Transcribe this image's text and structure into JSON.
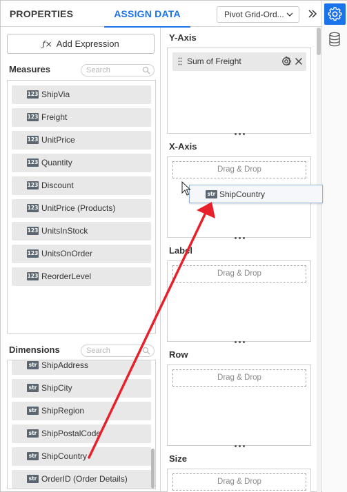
{
  "header": {
    "tabs": [
      {
        "label": "PROPERTIES",
        "active": false
      },
      {
        "label": "ASSIGN DATA",
        "active": true
      }
    ],
    "widget_select": "Pivot Grid-Ord..."
  },
  "left_panel": {
    "add_expression": "Add Expression",
    "add_expression_icon": "fx-icon",
    "measures": {
      "title": "Measures",
      "search_placeholder": "Search",
      "items": [
        {
          "badge": "123",
          "label": "ShipVia"
        },
        {
          "badge": "123",
          "label": "Freight"
        },
        {
          "badge": "123",
          "label": "UnitPrice"
        },
        {
          "badge": "123",
          "label": "Quantity"
        },
        {
          "badge": "123",
          "label": "Discount"
        },
        {
          "badge": "123",
          "label": "UnitPrice (Products)"
        },
        {
          "badge": "123",
          "label": "UnitsInStock"
        },
        {
          "badge": "123",
          "label": "UnitsOnOrder"
        },
        {
          "badge": "123",
          "label": "ReorderLevel"
        }
      ]
    },
    "dimensions": {
      "title": "Dimensions",
      "search_placeholder": "Search",
      "items": [
        {
          "badge": "str",
          "label": "ShipAddress"
        },
        {
          "badge": "str",
          "label": "ShipCity"
        },
        {
          "badge": "str",
          "label": "ShipRegion"
        },
        {
          "badge": "str",
          "label": "ShipPostalCode"
        },
        {
          "badge": "str",
          "label": "ShipCountry"
        },
        {
          "badge": "str",
          "label": "OrderID (Order Details)"
        }
      ]
    }
  },
  "axes": {
    "y_axis": {
      "title": "Y-Axis",
      "assigned": "Sum of Freight"
    },
    "x_axis": {
      "title": "X-Axis",
      "hint": "Drag & Drop"
    },
    "label": {
      "title": "Label",
      "hint": "Drag & Drop"
    },
    "row": {
      "title": "Row",
      "hint": "Drag & Drop"
    },
    "size": {
      "title": "Size",
      "hint": "Drag & Drop"
    }
  },
  "drag_ghost": {
    "badge": "str",
    "label": "ShipCountry"
  },
  "annotation": {
    "arrow_color": "#e8202a"
  },
  "colors": {
    "accent": "#1a73e8",
    "badge": "#5c6670",
    "field_bg": "#e8e8e8"
  }
}
